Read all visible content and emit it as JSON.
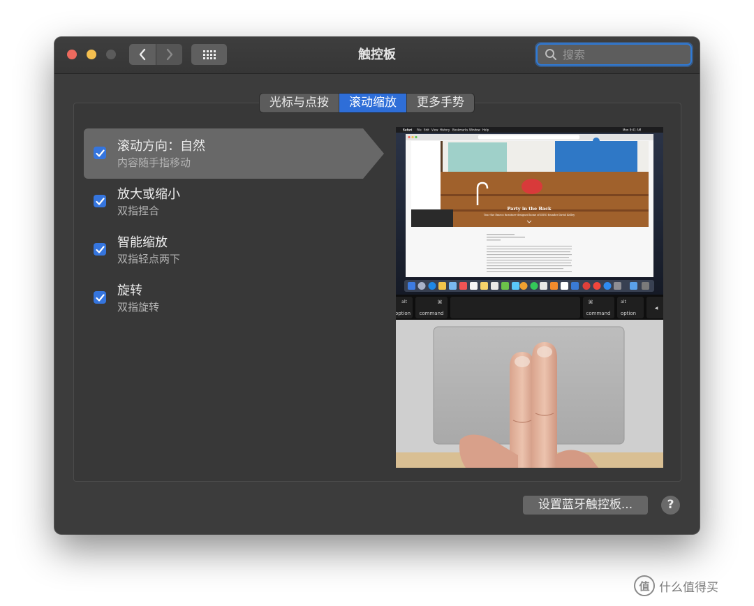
{
  "window": {
    "title": "触控板"
  },
  "toolbar": {
    "back_icon": "chevron-left-icon",
    "forward_icon": "chevron-right-icon",
    "grid_icon": "show-all-grid-icon"
  },
  "search": {
    "placeholder": "搜索",
    "value": ""
  },
  "tabs": [
    {
      "label": "光标与点按",
      "active": false
    },
    {
      "label": "滚动缩放",
      "active": true
    },
    {
      "label": "更多手势",
      "active": false
    }
  ],
  "options": [
    {
      "title": "滚动方向：自然",
      "subtitle": "内容随手指移动",
      "checked": true,
      "selected": true
    },
    {
      "title": "放大或缩小",
      "subtitle": "双指捏合",
      "checked": true,
      "selected": false
    },
    {
      "title": "智能缩放",
      "subtitle": "双指轻点两下",
      "checked": true,
      "selected": false
    },
    {
      "title": "旋转",
      "subtitle": "双指旋转",
      "checked": true,
      "selected": false
    }
  ],
  "preview": {
    "menubar": [
      "Safari",
      "File",
      "Edit",
      "View",
      "History",
      "Bookmarks",
      "Window",
      "Help"
    ],
    "clock": "Mon 9:41 AM",
    "headline": "Party in the Back",
    "subheadline": "Tour the Emeco furniture-designed home of IDEO founder David Kelley",
    "keys": {
      "left_alt": "alt",
      "left_option": "option",
      "left_cmd_symbol": "⌘",
      "left_command": "command",
      "right_cmd_symbol": "⌘",
      "right_command": "command",
      "right_alt": "alt",
      "right_option": "option",
      "arrow": "◀"
    }
  },
  "buttons": {
    "bluetooth": "设置蓝牙触控板...",
    "help": "?"
  },
  "watermark": {
    "icon": "值",
    "text": "什么值得买"
  },
  "colors": {
    "accent": "#2e6ed8",
    "checkbox": "#3575de",
    "window_bg": "#3c3c3c"
  }
}
